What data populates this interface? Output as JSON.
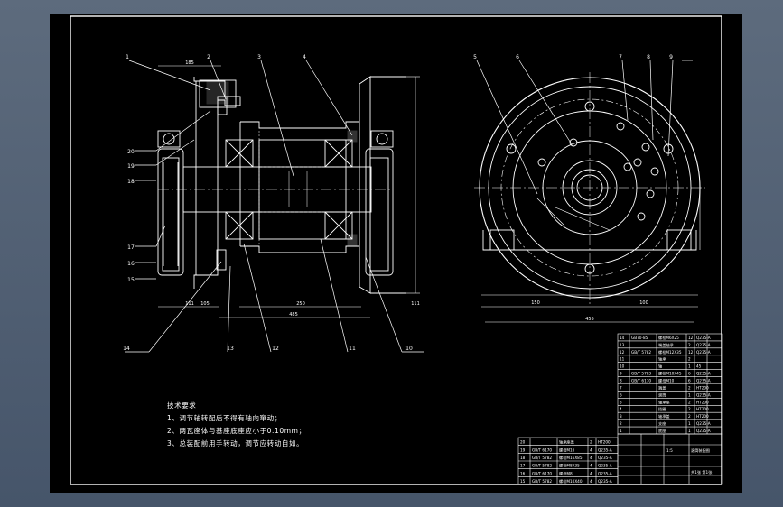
{
  "drawing": {
    "balloons_left": [
      "1",
      "2",
      "3",
      "4",
      "20",
      "19",
      "18",
      "17",
      "16",
      "15",
      "14",
      "13",
      "12",
      "11",
      "10"
    ],
    "balloons_right": [
      "5",
      "6",
      "7",
      "8",
      "9"
    ],
    "dims_left": [
      "185",
      "111",
      "105",
      "250",
      "111",
      "485"
    ],
    "dims_right": [
      "150",
      "100",
      "455"
    ]
  },
  "notes": {
    "title": "技术要求",
    "line1": "1、调节轴转配后不得有轴向窜动；",
    "line2": "2、两瓦座体与基座底座应小于0.10mm；",
    "line3": "3、总装配前用手转动，调节应转动自如。"
  },
  "parts_table": {
    "rows": [
      {
        "no": "14",
        "code": "GB70-85",
        "name": "螺栓M6X25",
        "qty": "12",
        "mat": "Q235-A"
      },
      {
        "no": "13",
        "code": "",
        "name": "端盖轴承",
        "qty": "2",
        "mat": "Q235-A"
      },
      {
        "no": "12",
        "code": "GB/T 5782",
        "name": "螺栓M12X35",
        "qty": "12",
        "mat": "Q235-A"
      },
      {
        "no": "11",
        "code": "",
        "name": "轴承",
        "qty": "2",
        "mat": ""
      },
      {
        "no": "10",
        "code": "",
        "name": "轴",
        "qty": "1",
        "mat": "45"
      },
      {
        "no": "9",
        "code": "GB/T 5783",
        "name": "螺栓M10X45",
        "qty": "6",
        "mat": "Q235-A"
      },
      {
        "no": "8",
        "code": "GB/T 6170",
        "name": "螺母M10",
        "qty": "6",
        "mat": "Q235-A"
      },
      {
        "no": "7",
        "code": "",
        "name": "端盖",
        "qty": "2",
        "mat": "HT200"
      },
      {
        "no": "6",
        "code": "",
        "name": "滚筒",
        "qty": "1",
        "mat": "Q235-A"
      },
      {
        "no": "5",
        "code": "",
        "name": "轴承座",
        "qty": "2",
        "mat": "HT200"
      },
      {
        "no": "4",
        "code": "",
        "name": "挡圈",
        "qty": "2",
        "mat": "HT200"
      },
      {
        "no": "3",
        "code": "",
        "name": "轴承盖",
        "qty": "2",
        "mat": "HT200"
      },
      {
        "no": "2",
        "code": "",
        "name": "支座",
        "qty": "1",
        "mat": "Q235-A"
      },
      {
        "no": "1",
        "code": "",
        "name": "底座",
        "qty": "1",
        "mat": "Q235-A"
      }
    ]
  },
  "parts_table2": {
    "rows": [
      {
        "no": "20",
        "code": "",
        "name": "轴承座盖",
        "qty": "2",
        "mat": "HT200"
      },
      {
        "no": "19",
        "code": "GB/T 6170",
        "name": "螺母M16",
        "qty": "4",
        "mat": "Q235-A"
      },
      {
        "no": "18",
        "code": "GB/T 5782",
        "name": "螺栓M16X85",
        "qty": "4",
        "mat": "Q235-A"
      },
      {
        "no": "17",
        "code": "GB/T 5782",
        "name": "螺栓M8X35",
        "qty": "4",
        "mat": "Q235-A"
      },
      {
        "no": "16",
        "code": "GB/T 6170",
        "name": "螺母M8",
        "qty": "4",
        "mat": "Q235-A"
      },
      {
        "no": "15",
        "code": "GB/T 5782",
        "name": "螺栓M10X40",
        "qty": "4",
        "mat": "Q235-A"
      }
    ]
  },
  "title_block": {
    "assembly": "滚筒装配图",
    "scale": "1:5",
    "sheet": "共1张 第1张"
  }
}
